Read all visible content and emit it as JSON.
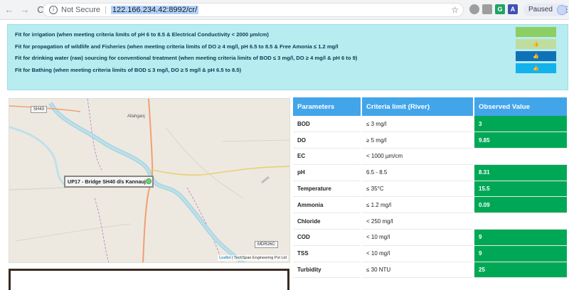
{
  "browser": {
    "back_icon": "←",
    "forward_icon": "→",
    "reload_icon": "C",
    "security_label": "Not Secure",
    "url": "122.166.234.42:8992/cr/",
    "bookmark_icon": "☆",
    "paused_label": "Paused"
  },
  "legend": {
    "rows": [
      {
        "text": "Fit for irrigation (when meeting criteria limits of pH 6 to 8.5 & Electrical Conductivity < 2000 µm/cm)",
        "color": "#8dce63"
      },
      {
        "text": "Fit for propagation of wildlife and Fisheries (when meeting criteria limits of DO ≥ 4 mg/l, pH 6.5 to 8.5 & Free Amonia ≤ 1.2 mg/l",
        "color": "#c0dda0"
      },
      {
        "text": "Fit for drinking water (raw) sourcing for conventional treatment (when meeting criteria limits of BOD ≤ 3 mg/l, DO ≥ 4 mg/l & pH 6 to 9)",
        "color": "#0f72b8"
      },
      {
        "text": "Fit for Bathing (when meeting criteria limits of BOD ≤ 3 mg/l, DO ≥ 5 mg/l & pH 6.5 to 8.5)",
        "color": "#12b2ec"
      }
    ],
    "thumb_glyph": "👍"
  },
  "map": {
    "labels": {
      "allahganj": "Allahganj",
      "sh43": "SH43",
      "mdr26c": "MDR26C"
    },
    "tooltip": "UP17 - Bridge SH40 d/s Kannauj",
    "attribution_leaflet": "Leaflet",
    "attribution_rest": "| TechSpan Engineering Pvt Ltd"
  },
  "table": {
    "headers": [
      "Parameters",
      "Criteria limit (River)",
      "Observed Value"
    ],
    "rows": [
      {
        "parameter": "BOD",
        "criteria": "≤ 3 mg/l",
        "observed": "3"
      },
      {
        "parameter": "DO",
        "criteria": "≥ 5 mg/l",
        "observed": "9.85"
      },
      {
        "parameter": "EC",
        "criteria": "< 1000 µm/cm",
        "observed": ""
      },
      {
        "parameter": "pH",
        "criteria": "6.5 - 8.5",
        "observed": "8.31"
      },
      {
        "parameter": "Temperature",
        "criteria": "≤ 35°C",
        "observed": "15.5"
      },
      {
        "parameter": "Ammonia",
        "criteria": "≤ 1.2 mg/l",
        "observed": "0.09"
      },
      {
        "parameter": "Chloride",
        "criteria": "< 250 mg/l",
        "observed": ""
      },
      {
        "parameter": "COD",
        "criteria": "< 10 mg/l",
        "observed": "9"
      },
      {
        "parameter": "TSS",
        "criteria": "< 10 mg/l",
        "observed": "9"
      },
      {
        "parameter": "Turbidity",
        "criteria": "≤ 30 NTU",
        "observed": "25"
      }
    ],
    "pass_color": "#00a856"
  }
}
